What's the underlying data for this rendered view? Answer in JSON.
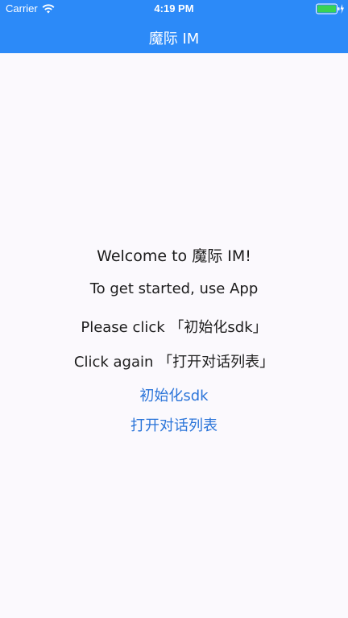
{
  "status_bar": {
    "carrier": "Carrier",
    "time": "4:19 PM",
    "wifi_icon": "wifi-icon",
    "battery_icon": "battery-icon",
    "battery_color": "#39d353"
  },
  "nav": {
    "title": "魔际 IM",
    "background": "#2c8af8"
  },
  "main": {
    "welcome": "Welcome to 魔际 IM!",
    "line_get_started": "To get started, use App",
    "line_please_click": "Please click 「初始化sdk」",
    "line_click_again": "Click again 「打开对话列表」",
    "init_sdk_button": "初始化sdk",
    "open_conversation_list_button": "打开对话列表",
    "link_color": "#2a74d9"
  }
}
